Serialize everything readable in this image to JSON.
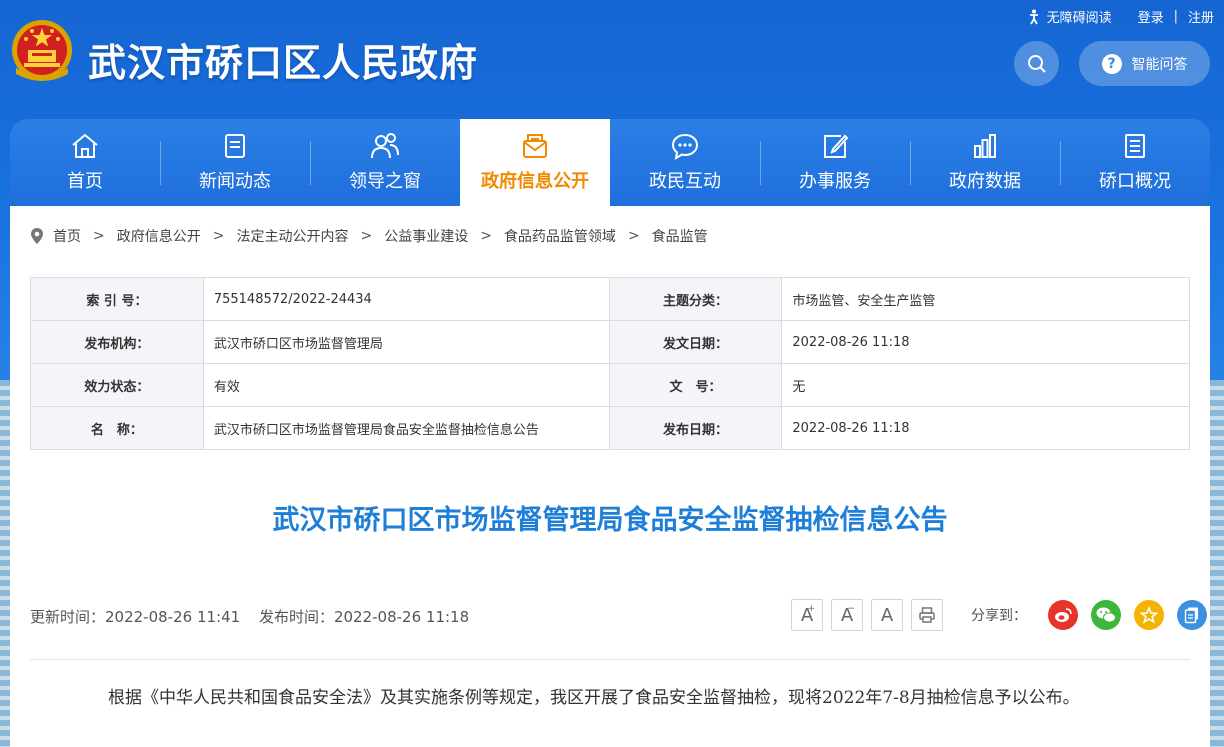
{
  "header": {
    "site_title": "武汉市硚口区人民政府",
    "accessibility_label": "无障碍阅读",
    "login_label": "登录",
    "register_label": "注册",
    "qa_label": "智能问答"
  },
  "nav": {
    "items": [
      {
        "label": "首页",
        "icon": "home-icon"
      },
      {
        "label": "新闻动态",
        "icon": "news-icon"
      },
      {
        "label": "领导之窗",
        "icon": "leaders-icon"
      },
      {
        "label": "政府信息公开",
        "icon": "mail-icon",
        "active": true
      },
      {
        "label": "政民互动",
        "icon": "chat-icon"
      },
      {
        "label": "办事服务",
        "icon": "edit-icon"
      },
      {
        "label": "政府数据",
        "icon": "bar-chart-icon"
      },
      {
        "label": "硚口概况",
        "icon": "document-icon"
      }
    ],
    "active_color": "#f08a00"
  },
  "breadcrumb": [
    "首页",
    "政府信息公开",
    "法定主动公开内容",
    "公益事业建设",
    "食品药品监管领域",
    "食品监管"
  ],
  "meta": {
    "index_label": "索 引 号：",
    "index_value": "755148572/2022-24434",
    "topic_label": "主题分类：",
    "topic_value": "市场监管、安全生产监管",
    "issuer_label": "发布机构：",
    "issuer_value": "武汉市硚口区市场监督管理局",
    "doc_date_label": "发文日期：",
    "doc_date_value": "2022-08-26 11:18",
    "status_label": "效力状态：",
    "status_value": "有效",
    "number_label": "文　号：",
    "number_value": "无",
    "name_label": "名　称：",
    "name_value": "武汉市硚口区市场监督管理局食品安全监督抽检信息公告",
    "pub_date_label": "发布日期：",
    "pub_date_value": "2022-08-26 11:18"
  },
  "doc": {
    "title": "武汉市硚口区市场监督管理局食品安全监督抽检信息公告",
    "title_color": "#1f7fd8",
    "updated": "更新时间：2022-08-26 11:41",
    "published": "发布时间：2022-08-26 11:18",
    "body": "根据《中华人民共和国食品安全法》及其实施条例等规定，我区开展了食品安全监督抽检，现将2022年7-8月抽检信息予以公布。"
  },
  "tools": {
    "font_large": "A",
    "font_medium": "A",
    "font_small": "A",
    "share_label": "分享到："
  }
}
